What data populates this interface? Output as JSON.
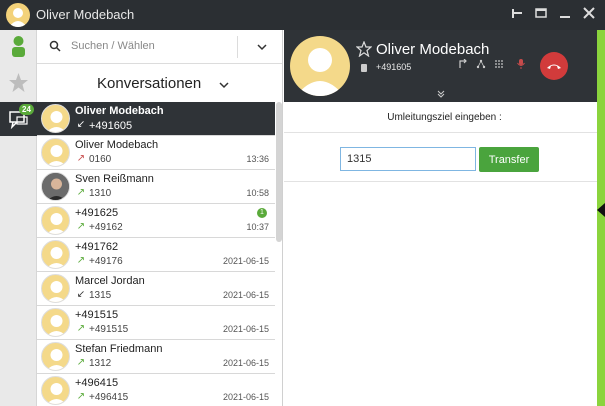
{
  "window": {
    "title": "Oliver Modebach",
    "controls": [
      "pin-icon",
      "restore-icon",
      "minimize-icon",
      "close-icon"
    ]
  },
  "rail": {
    "items": [
      {
        "icon": "contacts-icon"
      },
      {
        "icon": "favorites-star-icon"
      },
      {
        "icon": "conversations-icon",
        "badge": "24"
      }
    ]
  },
  "search": {
    "placeholder": "Suchen / Wählen"
  },
  "list": {
    "header": "Konversationen",
    "items": [
      {
        "name": "Oliver Modebach",
        "number": "+491605",
        "time": "",
        "direction": "incoming-active",
        "active": true,
        "avatar": "placeholder"
      },
      {
        "name": "Oliver Modebach",
        "number": "0160",
        "time": "13:36",
        "direction": "missed",
        "avatar": "placeholder"
      },
      {
        "name": "Sven Reißmann",
        "number": "1310",
        "time": "10:58",
        "direction": "outgoing",
        "avatar": "photo"
      },
      {
        "name": "+491625",
        "number": "+49162",
        "time": "10:37",
        "direction": "outgoing",
        "badge": "1",
        "avatar": "placeholder"
      },
      {
        "name": "+491762",
        "number": "+49176",
        "time": "2021-06-15",
        "direction": "outgoing",
        "avatar": "placeholder"
      },
      {
        "name": "Marcel Jordan",
        "number": "1315",
        "time": "2021-06-15",
        "direction": "incoming",
        "avatar": "placeholder"
      },
      {
        "name": "+491515",
        "number": "+491515",
        "time": "2021-06-15",
        "direction": "outgoing",
        "avatar": "placeholder"
      },
      {
        "name": "Stefan Friedmann",
        "number": "1312",
        "time": "2021-06-15",
        "direction": "outgoing",
        "avatar": "placeholder"
      },
      {
        "name": "+496415",
        "number": "+496415",
        "time": "2021-06-15",
        "direction": "outgoing",
        "avatar": "placeholder"
      }
    ]
  },
  "call": {
    "name": "Oliver Modebach",
    "number": "+491605",
    "icons": [
      "transfer-icon",
      "conference-icon",
      "keypad-icon",
      "mute-mic-icon"
    ],
    "hangup_icon": "hangup-icon"
  },
  "redirect": {
    "label": "Umleitungsziel eingeben :",
    "value": "1315",
    "button": "Transfer"
  },
  "colors": {
    "dark": "#2f3337",
    "accent_green": "#4aa43d",
    "hangup_red": "#d23b3b",
    "avatar_yellow": "#f4d98a",
    "edge_green": "#8bd43d"
  }
}
